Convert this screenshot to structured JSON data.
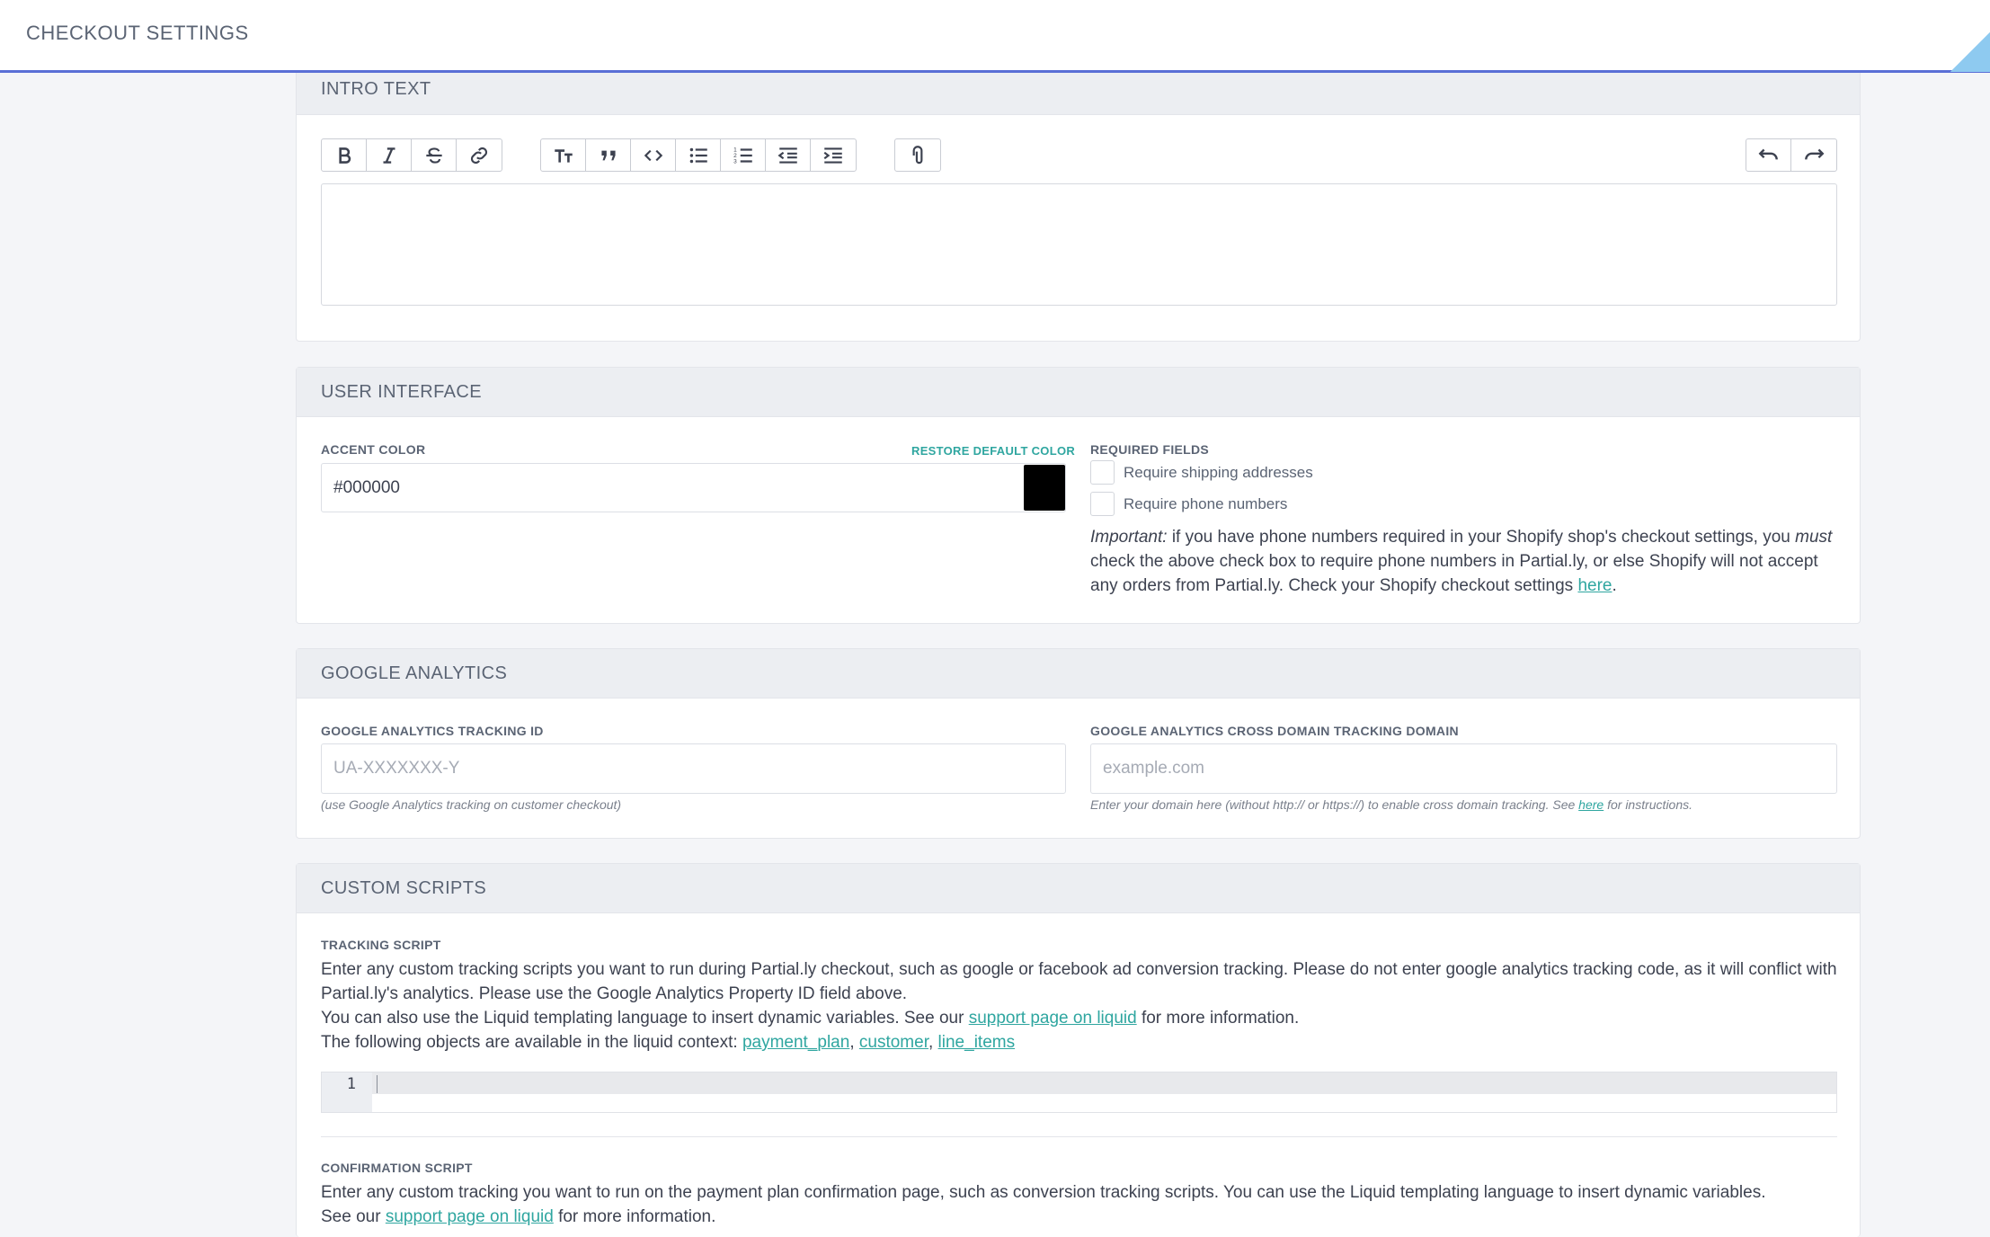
{
  "page": {
    "title": "CHECKOUT SETTINGS"
  },
  "intro_text": {
    "header": "INTRO TEXT",
    "toolbar": {
      "format_icons": [
        "bold-icon",
        "italic-icon",
        "strikethrough-icon",
        "link-icon"
      ],
      "block_icons": [
        "heading-icon",
        "quote-icon",
        "code-icon",
        "bullet-list-icon",
        "numbered-list-icon",
        "outdent-icon",
        "indent-icon"
      ],
      "attach_icon": "paperclip-icon",
      "history_icons": [
        "undo-icon",
        "redo-icon"
      ]
    },
    "content": ""
  },
  "user_interface": {
    "header": "USER INTERFACE",
    "accent_color_label": "ACCENT COLOR",
    "restore_default_label": "RESTORE DEFAULT COLOR",
    "accent_color_value": "#000000",
    "swatch_color": "#000000",
    "required_fields_label": "REQUIRED FIELDS",
    "require_shipping_label": "Require shipping addresses",
    "require_shipping_checked": false,
    "require_phone_label": "Require phone numbers",
    "require_phone_checked": false,
    "important_prefix": "Important:",
    "important_text_1": " if you have phone numbers required in your Shopify shop's checkout settings, you ",
    "important_must": "must",
    "important_text_2": " check the above check box to require phone numbers in Partial.ly, or else Shopify will not accept any orders from Partial.ly. Check your Shopify checkout settings ",
    "important_link": "here",
    "important_end": "."
  },
  "google_analytics": {
    "header": "GOOGLE ANALYTICS",
    "tracking_id_label": "GOOGLE ANALYTICS TRACKING ID",
    "tracking_id_placeholder": "UA-XXXXXXX-Y",
    "tracking_id_value": "",
    "tracking_id_hint": "(use Google Analytics tracking on customer checkout)",
    "cross_domain_label": "GOOGLE ANALYTICS CROSS DOMAIN TRACKING DOMAIN",
    "cross_domain_placeholder": "example.com",
    "cross_domain_value": "",
    "cross_domain_hint_1": "Enter your domain here (without http:// or https://) to enable cross domain tracking. See ",
    "cross_domain_hint_link": "here",
    "cross_domain_hint_2": " for instructions."
  },
  "custom_scripts": {
    "header": "CUSTOM SCRIPTS",
    "tracking_label": "TRACKING SCRIPT",
    "tracking_desc_1": "Enter any custom tracking scripts you want to run during Partial.ly checkout, such as google or facebook ad conversion tracking. Please do not enter google analytics tracking code, as it will conflict with Partial.ly's analytics. Please use the Google Analytics Property ID field above.",
    "tracking_desc_2_pre": "You can also use the Liquid templating language to insert dynamic variables. See our ",
    "tracking_desc_2_link": "support page on liquid",
    "tracking_desc_2_post": " for more information.",
    "tracking_desc_3_pre": "The following objects are available in the liquid context: ",
    "liquid_objects": [
      "payment_plan",
      "customer",
      "line_items"
    ],
    "sep": ", ",
    "line_number": "1",
    "confirmation_label": "CONFIRMATION SCRIPT",
    "confirmation_desc_1": "Enter any custom tracking you want to run on the payment plan confirmation page, such as conversion tracking scripts. You can use the Liquid templating language to insert dynamic variables.",
    "confirmation_desc_2_pre": "See our ",
    "confirmation_desc_2_link": "support page on liquid",
    "confirmation_desc_2_post": " for more information."
  },
  "colors": {
    "accent_link": "#2fa6a0",
    "topbar_border": "#5a6fd6"
  }
}
